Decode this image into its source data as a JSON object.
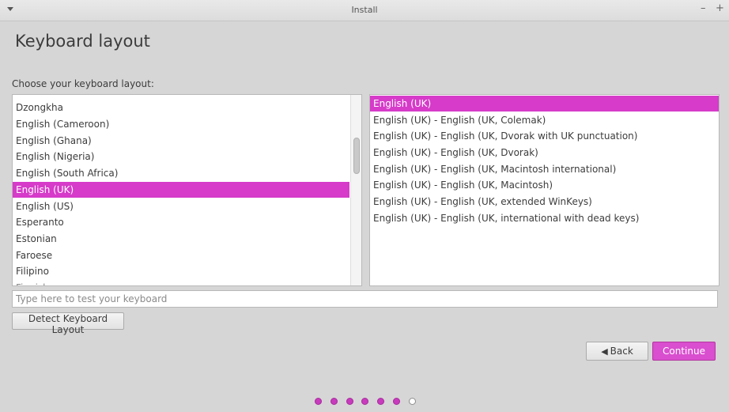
{
  "window": {
    "title": "Install",
    "minimize_glyph": "–",
    "maximize_glyph": "+"
  },
  "page": {
    "heading": "Keyboard layout",
    "prompt": "Choose your keyboard layout:"
  },
  "layouts": {
    "items": [
      "Dzongkha",
      "English (Cameroon)",
      "English (Ghana)",
      "English (Nigeria)",
      "English (South Africa)",
      "English (UK)",
      "English (US)",
      "Esperanto",
      "Estonian",
      "Faroese",
      "Filipino"
    ],
    "selected": "English (UK)",
    "partial_item": "Finnish"
  },
  "variants": {
    "items": [
      "English (UK)",
      "English (UK) - English (UK, Colemak)",
      "English (UK) - English (UK, Dvorak with UK punctuation)",
      "English (UK) - English (UK, Dvorak)",
      "English (UK) - English (UK, Macintosh international)",
      "English (UK) - English (UK, Macintosh)",
      "English (UK) - English (UK, extended WinKeys)",
      "English (UK) - English (UK, international with dead keys)"
    ],
    "selected": "English (UK)"
  },
  "test_field": {
    "placeholder": "Type here to test your keyboard",
    "value": ""
  },
  "buttons": {
    "detect": "Detect Keyboard Layout",
    "back": "Back",
    "continue": "Continue"
  },
  "progress": {
    "total_steps": 7,
    "completed_steps": 6
  },
  "colors": {
    "accent": "#d63bc9",
    "continue_bg": "#d94fcf"
  }
}
